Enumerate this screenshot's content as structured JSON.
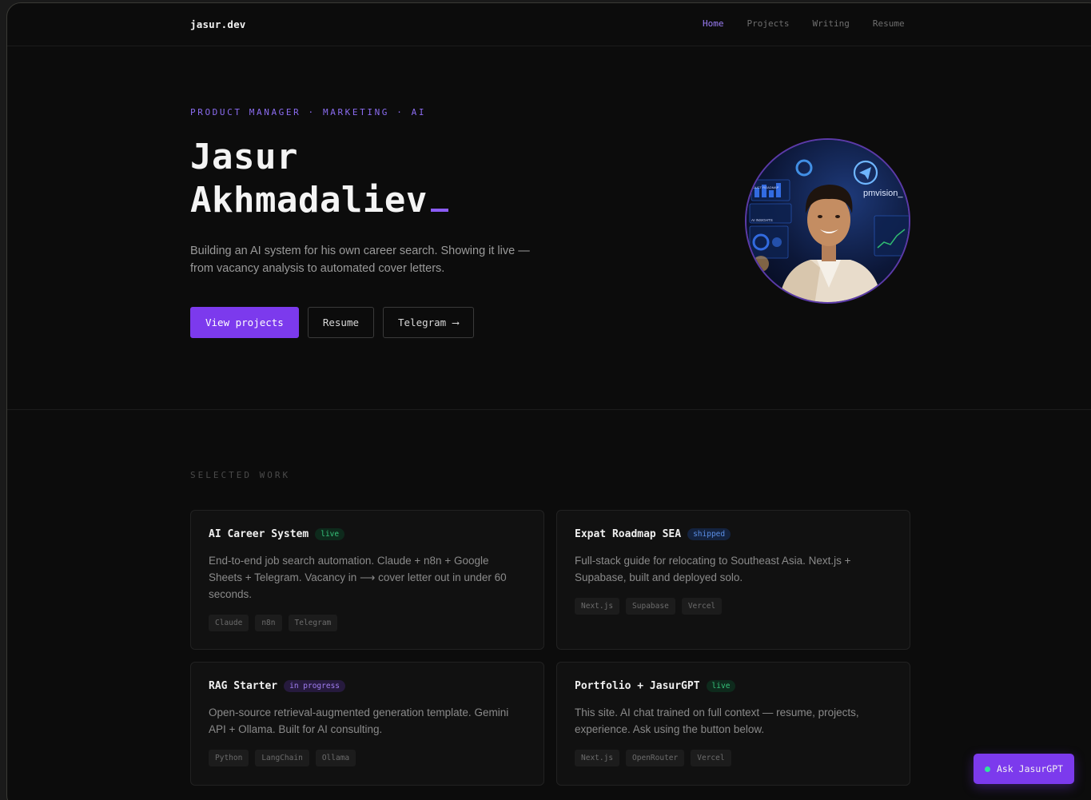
{
  "nav": {
    "logo": "jasur.dev",
    "links": [
      {
        "label": "Home",
        "active": true
      },
      {
        "label": "Projects",
        "active": false
      },
      {
        "label": "Writing",
        "active": false
      },
      {
        "label": "Resume",
        "active": false
      }
    ]
  },
  "hero": {
    "eyebrow": "PRODUCT MANAGER · MARKETING · AI",
    "name_line1": "Jasur",
    "name_line2": "Akhmadaliev",
    "bio": "Building an AI system for his own career search. Showing it live — from vacancy analysis to automated cover letters.",
    "buttons": {
      "primary": "View projects",
      "resume": "Resume",
      "telegram": "Telegram",
      "telegram_arrow": "⟶"
    },
    "avatar_overlay": {
      "brand": "pmvision_",
      "label1": "DUCT ROADMAP",
      "label2": "AI INSIGHTS"
    }
  },
  "work": {
    "section_title": "SELECTED WORK",
    "projects": [
      {
        "title": "AI Career System",
        "status": "live",
        "desc": "End-to-end job search automation. Claude + n8n + Google Sheets + Telegram. Vacancy in ⟶ cover letter out in under 60 seconds.",
        "tags": [
          "Claude",
          "n8n",
          "Telegram"
        ]
      },
      {
        "title": "Expat Roadmap SEA",
        "status": "shipped",
        "desc": "Full-stack guide for relocating to Southeast Asia. Next.js + Supabase, built and deployed solo.",
        "tags": [
          "Next.js",
          "Supabase",
          "Vercel"
        ]
      },
      {
        "title": "RAG Starter",
        "status": "in progress",
        "desc": "Open-source retrieval-augmented generation template. Gemini API + Ollama. Built for AI consulting.",
        "tags": [
          "Python",
          "LangChain",
          "Ollama"
        ]
      },
      {
        "title": "Portfolio + JasurGPT",
        "status": "live",
        "desc": "This site. AI chat trained on full context — resume, projects, experience. Ask using the button below.",
        "tags": [
          "Next.js",
          "OpenRouter",
          "Vercel"
        ]
      }
    ]
  },
  "chat_button": {
    "label": "Ask JasurGPT"
  },
  "colors": {
    "accent": "#7c3aed",
    "accent_text": "#9b7df5",
    "background": "#0c0c0c",
    "live": "#36c27a",
    "shipped": "#5b8fe6",
    "in_progress": "#a07df0"
  }
}
